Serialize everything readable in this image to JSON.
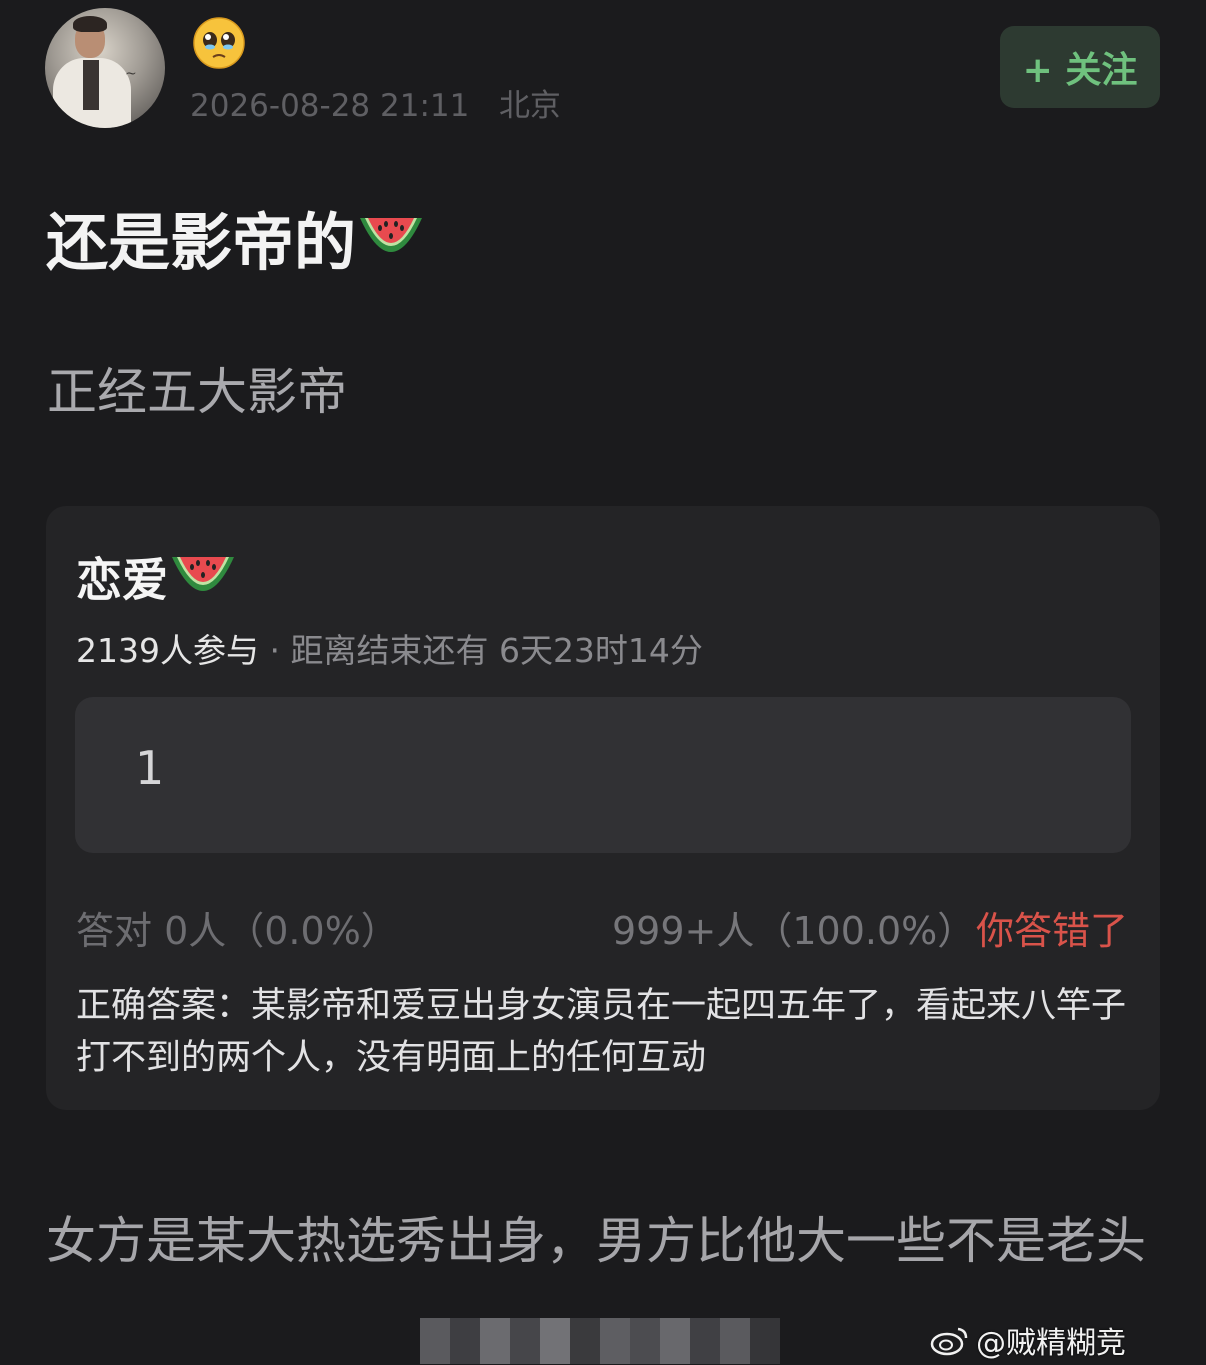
{
  "post": {
    "emoji": "pleading-face-icon",
    "timestamp": "2026-08-28 21:11",
    "location": "北京",
    "follow_label": "+ 关注",
    "title": "还是影帝的",
    "title_emoji": "watermelon-icon",
    "subtitle": "正经五大影帝"
  },
  "quiz": {
    "title": "恋爱",
    "title_emoji": "watermelon-icon",
    "participants": "2139人参与",
    "time_left": " · 距离结束还有 6天23时14分",
    "option_text": "1",
    "correct_stat": "答对  0人（0.0%）",
    "wrong_stat": "999+人（100.0%）",
    "wrong_label": "你答错了",
    "answer": "正确答案：某影帝和爱豆出身女演员在一起四五年了，看起来八竿子打不到的两个人，没有明面上的任何互动"
  },
  "body": {
    "text": "女方是某大热选秀出身，男方比他大一些不是老头"
  },
  "watermark": {
    "text": "@贼精糊竞"
  },
  "colors": {
    "background": "#1b1b1d",
    "follow_green": "#6fc17e",
    "wrong_red": "#d9534a"
  }
}
